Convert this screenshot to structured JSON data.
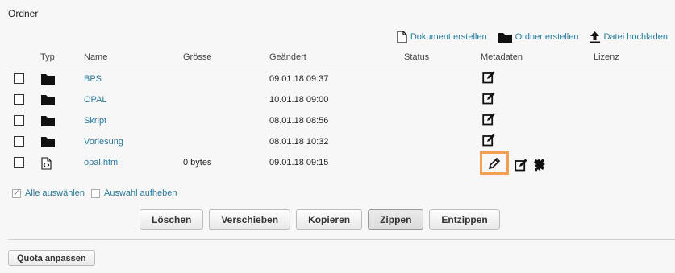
{
  "page": {
    "title": "Ordner"
  },
  "actions": {
    "create_document": "Dokument erstellen",
    "create_folder": "Ordner erstellen",
    "upload_file": "Datei hochladen"
  },
  "table": {
    "headers": {
      "type": "Typ",
      "name": "Name",
      "size": "Grösse",
      "modified": "Geändert",
      "status": "Status",
      "metadata": "Metadaten",
      "license": "Lizenz"
    },
    "rows": [
      {
        "type": "folder",
        "name": "BPS",
        "size": "",
        "modified": "09.01.18 09:37"
      },
      {
        "type": "folder",
        "name": "OPAL",
        "size": "",
        "modified": "10.01.18 09:00"
      },
      {
        "type": "folder",
        "name": "Skript",
        "size": "",
        "modified": "08.01.18 08:56"
      },
      {
        "type": "folder",
        "name": "Vorlesung",
        "size": "",
        "modified": "08.01.18 10:32"
      },
      {
        "type": "html-file",
        "name": "opal.html",
        "size": "0 bytes",
        "modified": "09.01.18 09:15"
      }
    ]
  },
  "selection": {
    "select_all": "Alle auswählen",
    "deselect": "Auswahl aufheben"
  },
  "buttons": {
    "delete": "Löschen",
    "move": "Verschieben",
    "copy": "Kopieren",
    "zip": "Zippen",
    "unzip": "Entzippen"
  },
  "quota": {
    "label": "Quota anpassen"
  },
  "colors": {
    "link": "#2a7a9a",
    "highlight": "#f0a050"
  }
}
